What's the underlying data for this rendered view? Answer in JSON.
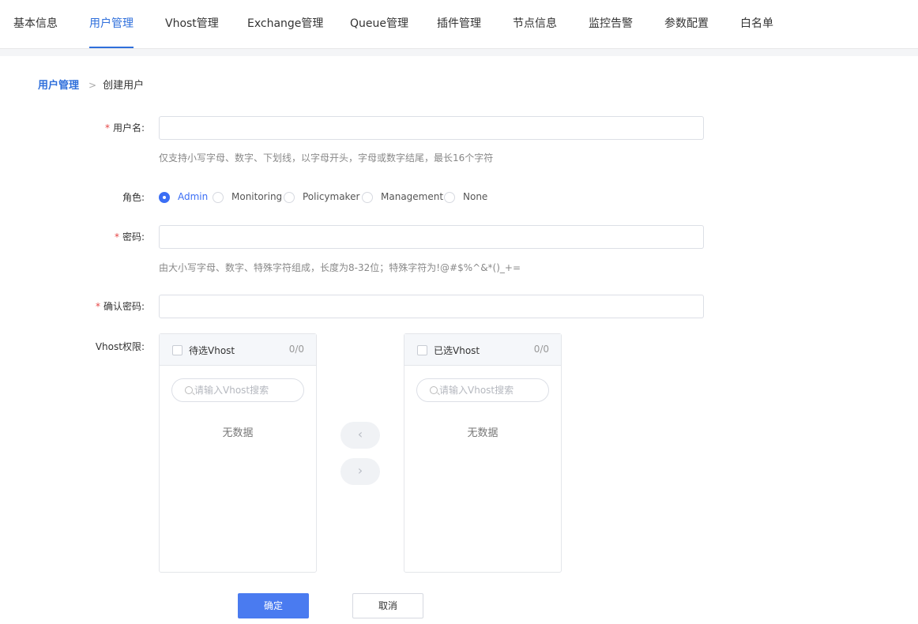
{
  "nav": {
    "tabs": [
      {
        "label": "基本信息"
      },
      {
        "label": "用户管理"
      },
      {
        "label": "Vhost管理"
      },
      {
        "label": "Exchange管理"
      },
      {
        "label": "Queue管理"
      },
      {
        "label": "插件管理"
      },
      {
        "label": "节点信息"
      },
      {
        "label": "监控告警"
      },
      {
        "label": "参数配置"
      },
      {
        "label": "白名单"
      }
    ],
    "active_tab": "用户管理"
  },
  "breadcrumb": {
    "root": "用户管理",
    "separator": ">",
    "current": "创建用户"
  },
  "form": {
    "required_mark": "*",
    "username": {
      "label": "用户名:",
      "value": "",
      "hint": "仅支持小写字母、数字、下划线，以字母开头，字母或数字结尾，最长16个字符"
    },
    "role": {
      "label": "角色:",
      "options": [
        "Admin",
        "Monitoring",
        "Policymaker",
        "Management",
        "None"
      ],
      "selected": "Admin"
    },
    "password": {
      "label": "密码:",
      "value": "",
      "hint": "由大小写字母、数字、特殊字符组成，长度为8-32位；特殊字符为!@#$%^&*()_+="
    },
    "confirm_password": {
      "label": "确认密码:",
      "value": ""
    },
    "vhost": {
      "label": "Vhost权限:",
      "left": {
        "title": "待选Vhost",
        "count": "0/0",
        "search_placeholder": "请输入Vhost搜索",
        "empty_text": "无数据"
      },
      "right": {
        "title": "已选Vhost",
        "count": "0/0",
        "search_placeholder": "请输入Vhost搜索",
        "empty_text": "无数据"
      },
      "move_left_icon": "chevron-left-icon",
      "move_right_icon": "chevron-right-icon"
    }
  },
  "actions": {
    "confirm_label": "确定",
    "cancel_label": "取消"
  },
  "colors": {
    "accent": "#2f6fdb",
    "primary_button": "#4a7bf0",
    "required": "#e64545"
  }
}
